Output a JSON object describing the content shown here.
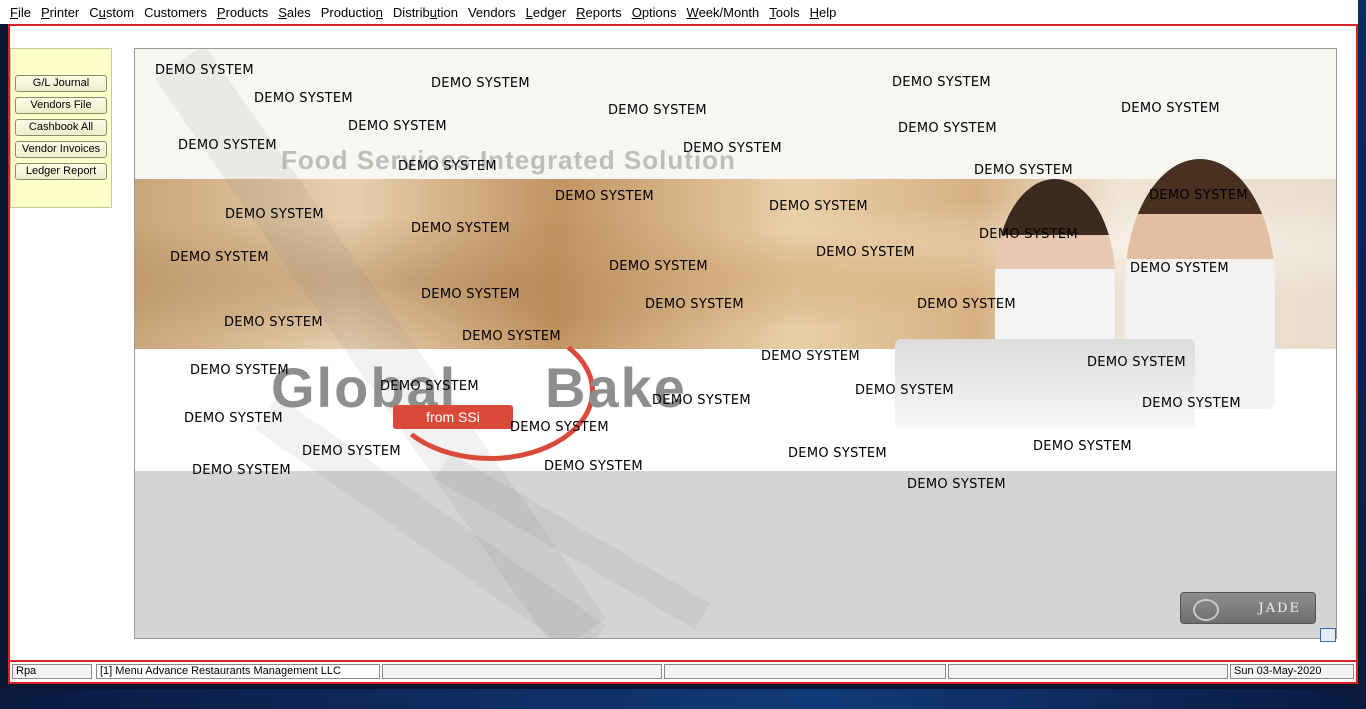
{
  "menubar": {
    "items": [
      {
        "pre": "",
        "ul": "F",
        "post": "ile"
      },
      {
        "pre": "",
        "ul": "P",
        "post": "rinter"
      },
      {
        "pre": "C",
        "ul": "u",
        "post": "stom"
      },
      {
        "pre": "Customers",
        "ul": "",
        "post": ""
      },
      {
        "pre": "",
        "ul": "P",
        "post": "roducts"
      },
      {
        "pre": "",
        "ul": "S",
        "post": "ales"
      },
      {
        "pre": "Productio",
        "ul": "n",
        "post": ""
      },
      {
        "pre": "Distrib",
        "ul": "u",
        "post": "tion"
      },
      {
        "pre": "Vendors",
        "ul": "",
        "post": ""
      },
      {
        "pre": "",
        "ul": "L",
        "post": "edger"
      },
      {
        "pre": "",
        "ul": "R",
        "post": "eports"
      },
      {
        "pre": "",
        "ul": "O",
        "post": "ptions"
      },
      {
        "pre": "",
        "ul": "W",
        "post": "eek/Month"
      },
      {
        "pre": "",
        "ul": "T",
        "post": "ools"
      },
      {
        "pre": "",
        "ul": "H",
        "post": "elp"
      }
    ]
  },
  "shortcuts": [
    "G/L Journal",
    "Vendors File",
    "Cashbook All",
    "Vendor Invoices",
    "Ledger Report"
  ],
  "splash": {
    "tagline": "Food Services Integrated Solution",
    "logo_word_1": "Global",
    "logo_word_2": "Bake",
    "logo_sub": "from SSi",
    "watermark_text": "DEMO SYSTEM",
    "badge_text": "JADE"
  },
  "statusbar": {
    "user": "Rpa",
    "company": "[1] Menu Advance Restaurants Management LLC",
    "date": "Sun 03-May-2020"
  },
  "colors": {
    "frame_border": "#d42424",
    "shortcut_panel": "#ffffcc",
    "logo_red": "#d94a3a"
  }
}
